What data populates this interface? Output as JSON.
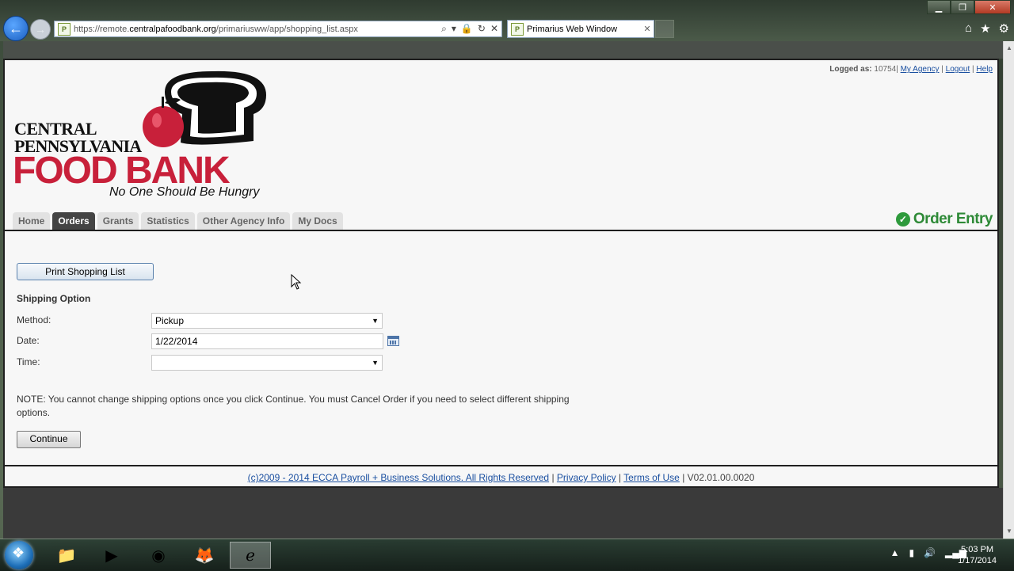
{
  "browser": {
    "url_prefix": "https://remote.",
    "url_domain": "centralpafoodbank.org",
    "url_path": "/primariusww/app/shopping_list.aspx",
    "tab_title": "Primarius Web Window",
    "favicon_text": "P"
  },
  "header": {
    "logged_as_label": "Logged as:",
    "logged_as_value": "10754",
    "links": [
      "My Agency",
      "Logout",
      "Help"
    ]
  },
  "logo": {
    "line1": "CENTRAL",
    "line2": "PENNSYLVANIA",
    "line3": "FOOD BANK",
    "tagline": "No One Should Be Hungry"
  },
  "nav": {
    "tabs": [
      {
        "label": "Home",
        "active": false
      },
      {
        "label": "Orders",
        "active": true
      },
      {
        "label": "Grants",
        "active": false
      },
      {
        "label": "Statistics",
        "active": false
      },
      {
        "label": "Other Agency Info",
        "active": false
      },
      {
        "label": "My Docs",
        "active": false
      }
    ],
    "order_entry": "Order Entry"
  },
  "form": {
    "print_button": "Print Shopping List",
    "section_title": "Shipping Option",
    "method_label": "Method:",
    "method_value": "Pickup",
    "date_label": "Date:",
    "date_value": "1/22/2014",
    "time_label": "Time:",
    "time_value": "",
    "note": "NOTE: You cannot change shipping options once you click Continue. You must Cancel Order if you need to select different shipping options.",
    "continue_button": "Continue"
  },
  "footer": {
    "copyright": "(c)2009 - 2014 ECCA Payroll + Business Solutions. All Rights Reserved",
    "privacy": "Privacy Policy",
    "terms": "Terms of Use",
    "version": "V02.01.00.0020"
  },
  "taskbar": {
    "time": "5:03 PM",
    "date": "1/17/2014"
  },
  "colors": {
    "brand_red": "#c8203a",
    "order_entry_green": "#2e8a37",
    "link_blue": "#1a4fa0"
  }
}
